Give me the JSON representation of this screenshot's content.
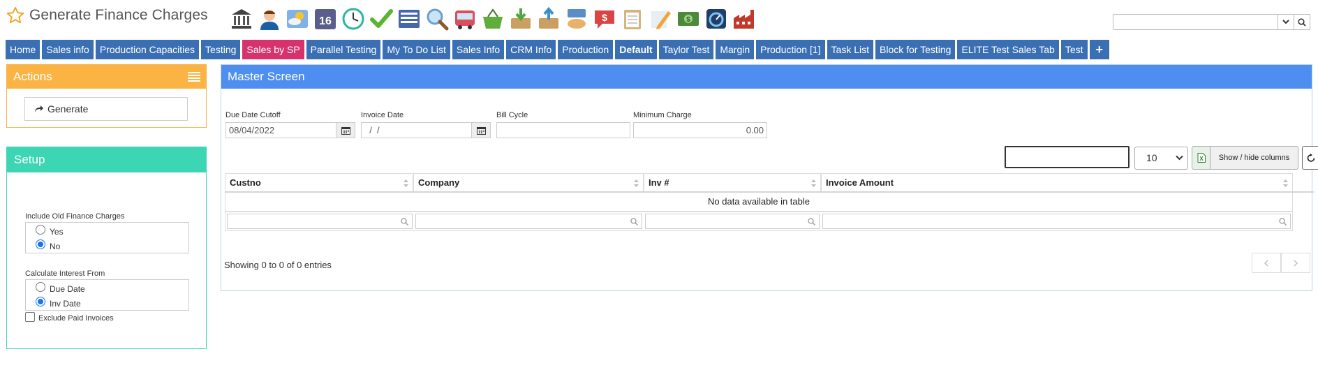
{
  "page": {
    "title": "Generate Finance Charges"
  },
  "toolbar_icons": [
    "bank-icon",
    "user-profile-icon",
    "weather-icon",
    "calendar-16-icon",
    "clock-icon",
    "checkmark-icon",
    "list-grid-icon",
    "magnifier-icon",
    "bus-icon",
    "basket-icon",
    "inbox-download-icon",
    "inbox-upload-icon",
    "coin-hand-icon",
    "dollar-speech-icon",
    "clipboard-icon",
    "pencil-note-icon",
    "money-icon",
    "tachometer-icon",
    "factory-icon"
  ],
  "global_search": {
    "value": ""
  },
  "tabs": [
    {
      "label": "Home"
    },
    {
      "label": "Sales info"
    },
    {
      "label": "Production Capacities"
    },
    {
      "label": "Testing"
    },
    {
      "label": "Sales by SP"
    },
    {
      "label": "Parallel Testing"
    },
    {
      "label": "My To Do List"
    },
    {
      "label": "Sales Info"
    },
    {
      "label": "CRM Info"
    },
    {
      "label": "Production"
    },
    {
      "label": "Default"
    },
    {
      "label": "Taylor Test"
    },
    {
      "label": "Margin"
    },
    {
      "label": "Production [1]"
    },
    {
      "label": "Task List"
    },
    {
      "label": "Block for Testing"
    },
    {
      "label": "ELITE Test Sales Tab"
    },
    {
      "label": "Test"
    },
    {
      "label": "+"
    }
  ],
  "actions": {
    "title": "Actions",
    "generate_label": "Generate"
  },
  "setup": {
    "title": "Setup",
    "old_charges": {
      "label": "Include Old Finance Charges",
      "yes": "Yes",
      "no": "No",
      "selected": "No"
    },
    "interest_from": {
      "label": "Calculate Interest From",
      "due": "Due Date",
      "inv": "Inv Date",
      "selected": "Inv Date"
    },
    "exclude_paid_label": "Exclude Paid Invoices",
    "exclude_paid_checked": false
  },
  "master": {
    "title": "Master Screen",
    "due_date_cutoff": {
      "label": "Due Date Cutoff",
      "value": "08/04/2022"
    },
    "invoice_date": {
      "label": "Invoice Date",
      "value": "  /  /"
    },
    "bill_cycle": {
      "label": "Bill Cycle",
      "value": ""
    },
    "minimum_charge": {
      "label": "Minimum Charge",
      "value": "0.00"
    },
    "page_size": "10",
    "show_hide_label": "Show / hide columns",
    "columns": [
      "Custno",
      "Company",
      "Inv #",
      "Invoice Amount"
    ],
    "empty_text": "No data available in table",
    "info_text": "Showing 0 to 0 of 0 entries"
  },
  "colors": {
    "tab_blue": "#3a6fb4",
    "tab_pink": "#d6336c",
    "actions_orange": "#fbb444",
    "setup_teal": "#3dd6b5",
    "master_blue": "#4d8ef0"
  }
}
